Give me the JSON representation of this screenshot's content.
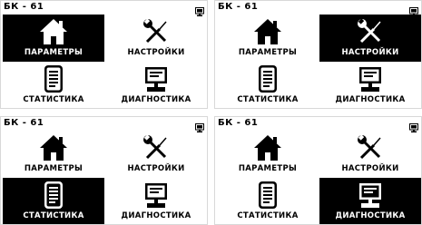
{
  "screens": [
    {
      "title": "БК - 61",
      "selected": "params"
    },
    {
      "title": "БК - 61",
      "selected": "settings"
    },
    {
      "title": "БК - 61",
      "selected": "stats"
    },
    {
      "title": "БК - 61",
      "selected": "diag"
    }
  ],
  "menu": {
    "params_label": "ПАРАМЕТРЫ",
    "settings_label": "НАСТРОЙКИ",
    "stats_label": "СТАТИСТИКА",
    "diag_label": "ДИАГНОСТИКА"
  },
  "icons": {
    "params": "home-icon",
    "settings": "tools-icon",
    "stats": "document-icon",
    "diag": "computer-icon",
    "header": "monitor-icon"
  },
  "colors": {
    "selected_bg": "#000000",
    "selected_fg": "#ffffff",
    "normal_fg": "#000000"
  }
}
